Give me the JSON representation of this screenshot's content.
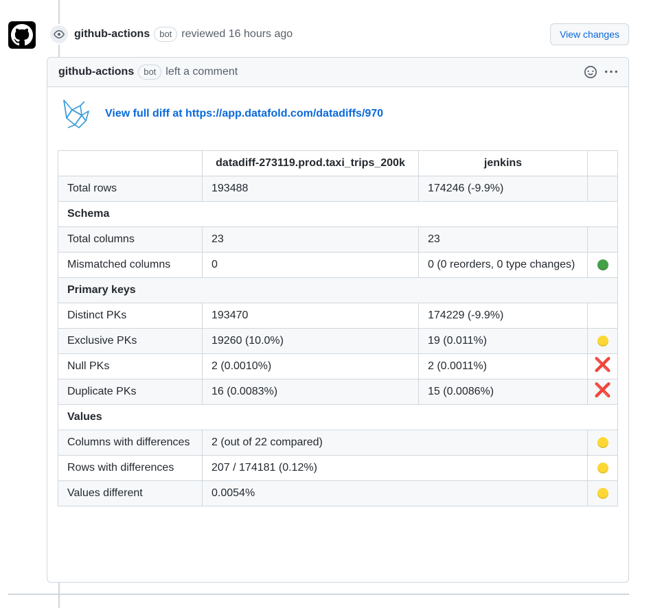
{
  "event": {
    "author": "github-actions",
    "badge": "bot",
    "action": "reviewed 16 hours ago",
    "view_changes_label": "View changes"
  },
  "comment": {
    "author": "github-actions",
    "badge": "bot",
    "action": "left a comment",
    "link_text": "View full diff at https://app.datafold.com/datadiffs/970"
  },
  "table": {
    "headers": [
      "",
      "datadiff-273119.prod.taxi_trips_200k",
      "jenkins",
      ""
    ],
    "rows": {
      "total_rows": {
        "label": "Total rows",
        "a": "193488",
        "b": "174246 (-9.9%)"
      },
      "schema": {
        "label": "Schema"
      },
      "total_columns": {
        "label": "Total columns",
        "a": "23",
        "b": "23"
      },
      "mismatched_columns": {
        "label": "Mismatched columns",
        "a": "0",
        "b": "0 (0 reorders, 0 type changes)",
        "status": "green"
      },
      "primary_keys": {
        "label": "Primary keys"
      },
      "distinct_pks": {
        "label": "Distinct PKs",
        "a": "193470",
        "b": "174229 (-9.9%)"
      },
      "exclusive_pks": {
        "label": "Exclusive PKs",
        "a": "19260 (10.0%)",
        "b": "19 (0.011%)",
        "status": "yellow"
      },
      "null_pks": {
        "label": "Null PKs",
        "a": "2 (0.0010%)",
        "b": "2 (0.0011%)",
        "status": "cross",
        "status_glyph": "❌"
      },
      "duplicate_pks": {
        "label": "Duplicate PKs",
        "a": "16 (0.0083%)",
        "b": "15 (0.0086%)",
        "status": "cross",
        "status_glyph": "❌"
      },
      "values": {
        "label": "Values"
      },
      "columns_with_differences": {
        "label": "Columns with differences",
        "a": "2 (out of 22 compared)",
        "status": "yellow"
      },
      "rows_with_differences": {
        "label": "Rows with differences",
        "a": "207 / 174181 (0.12%)",
        "status": "yellow"
      },
      "values_different": {
        "label": "Values different",
        "a": "0.0054%",
        "status": "yellow"
      }
    }
  },
  "colors": {
    "link": "#0969da",
    "border": "#d0d7de",
    "header_bg": "#f6f8fa",
    "status_green": "#43a047",
    "status_yellow": "#fdd835",
    "status_red": "#e53935"
  },
  "icons": [
    "github-mark-icon",
    "eye-icon",
    "smiley-icon",
    "kebab-horizontal-icon",
    "datafold-logo-icon"
  ]
}
